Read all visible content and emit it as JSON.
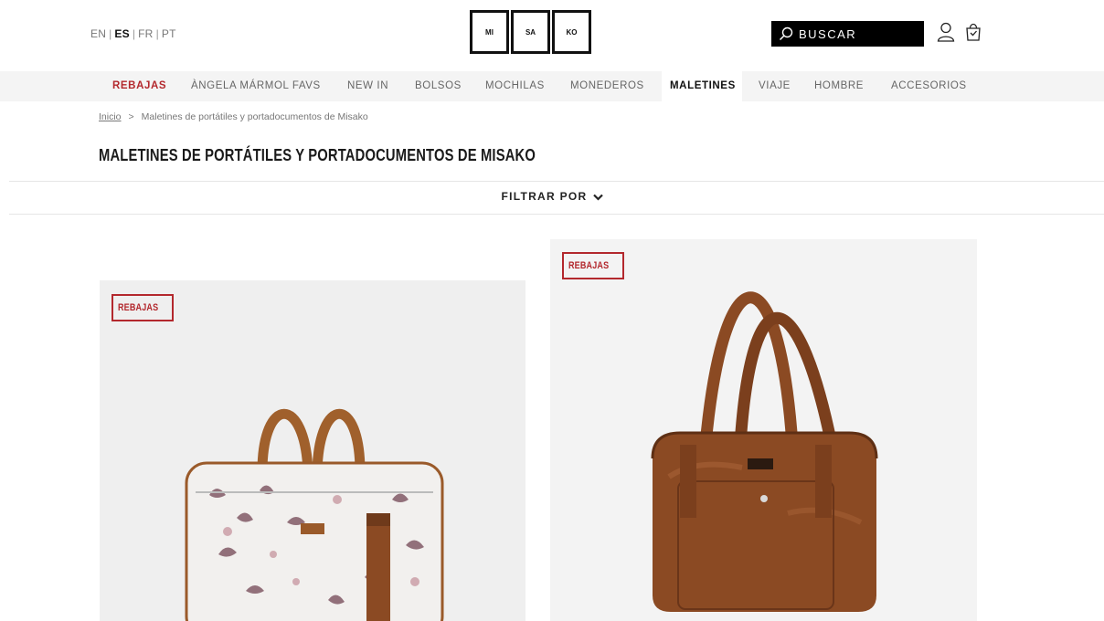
{
  "languages": [
    {
      "code": "EN",
      "active": false
    },
    {
      "code": "ES",
      "active": true
    },
    {
      "code": "FR",
      "active": false
    },
    {
      "code": "PT",
      "active": false
    }
  ],
  "language_separator": "|",
  "logo": [
    "MI",
    "SA",
    "KO"
  ],
  "search": {
    "placeholder": "BUSCAR"
  },
  "icons": {
    "search": "search-icon",
    "account": "user-icon",
    "cart": "shopping-bag-icon",
    "filter": "chevron-down-icon"
  },
  "nav": [
    {
      "label": "REBAJAS",
      "style": "sale"
    },
    {
      "label": "ÀNGELA MÁRMOL FAVS",
      "style": "normal"
    },
    {
      "label": "NEW IN",
      "style": "normal"
    },
    {
      "label": "BOLSOS",
      "style": "normal"
    },
    {
      "label": "MOCHILAS",
      "style": "normal"
    },
    {
      "label": "MONEDEROS",
      "style": "normal"
    },
    {
      "label": "MALETINES",
      "style": "active"
    },
    {
      "label": "VIAJE",
      "style": "normal"
    },
    {
      "label": "HOMBRE",
      "style": "normal"
    },
    {
      "label": "ACCESORIOS",
      "style": "normal"
    }
  ],
  "breadcrumb": {
    "home": "Inicio",
    "separator": ">",
    "current": "Maletines de portátiles y portadocumentos de Misako"
  },
  "page_title": "MALETINES DE PORTÁTILES Y PORTADOCUMENTOS DE MISAKO",
  "filter_label": "FILTRAR POR",
  "products": [
    {
      "badge": "REBAJAS",
      "image": "floral-print-laptop-briefcase"
    },
    {
      "badge": "REBAJAS",
      "image": "brown-leather-briefcase"
    }
  ],
  "colors": {
    "sale": "#b3282d",
    "nav_bg": "#f4f4f4",
    "brown": "#8b4a23"
  }
}
